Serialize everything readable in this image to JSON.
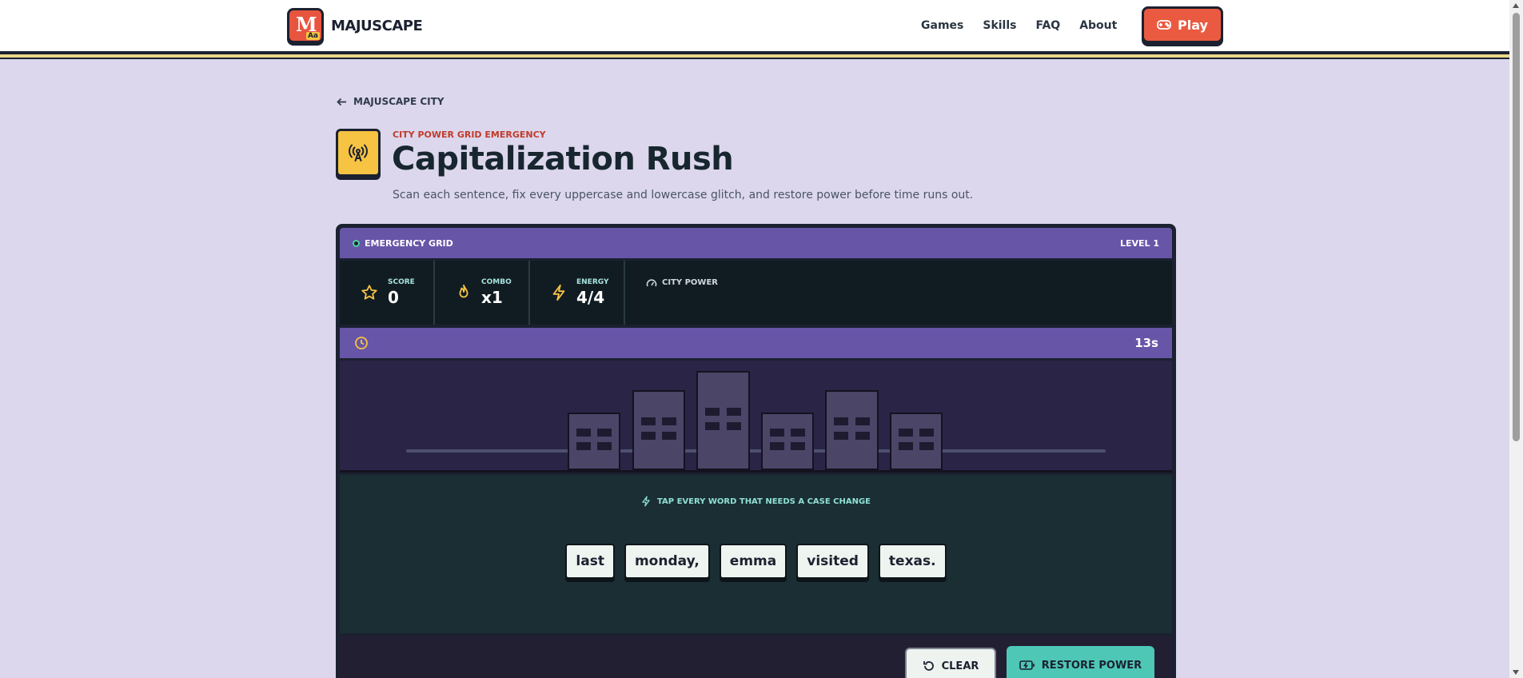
{
  "header": {
    "logo_text": "MAJUSCAPE",
    "logo_letter": "M",
    "logo_badge": "Aa",
    "nav": [
      {
        "label": "Games"
      },
      {
        "label": "Skills"
      },
      {
        "label": "FAQ"
      },
      {
        "label": "About"
      }
    ],
    "play_label": "Play"
  },
  "breadcrumb": {
    "back_label": "MAJUSCAPE CITY"
  },
  "hero": {
    "eyebrow": "CITY POWER GRID EMERGENCY",
    "title": "Capitalization Rush",
    "subtitle": "Scan each sentence, fix every uppercase and lowercase glitch, and restore power before time runs out."
  },
  "panel": {
    "header_label": "EMERGENCY GRID",
    "level": "LEVEL 1",
    "stats": [
      {
        "label": "SCORE",
        "value": "0",
        "icon": "star-icon"
      },
      {
        "label": "COMBO",
        "value": "x1",
        "icon": "flame-icon"
      },
      {
        "label": "ENERGY",
        "value": "4/4",
        "icon": "lightning-icon"
      }
    ],
    "city_power_label": "CITY POWER",
    "timer": "13s",
    "instruction": "TAP EVERY WORD THAT NEEDS A CASE CHANGE",
    "words": [
      "last",
      "monday,",
      "emma",
      "visited",
      "texas."
    ],
    "clear_label": "CLEAR",
    "restore_label": "RESTORE POWER"
  },
  "colors": {
    "accent_purple": "#6755a8",
    "accent_coral": "#ea5a41",
    "accent_teal": "#4ec7b7",
    "accent_yellow": "#f6c343"
  }
}
